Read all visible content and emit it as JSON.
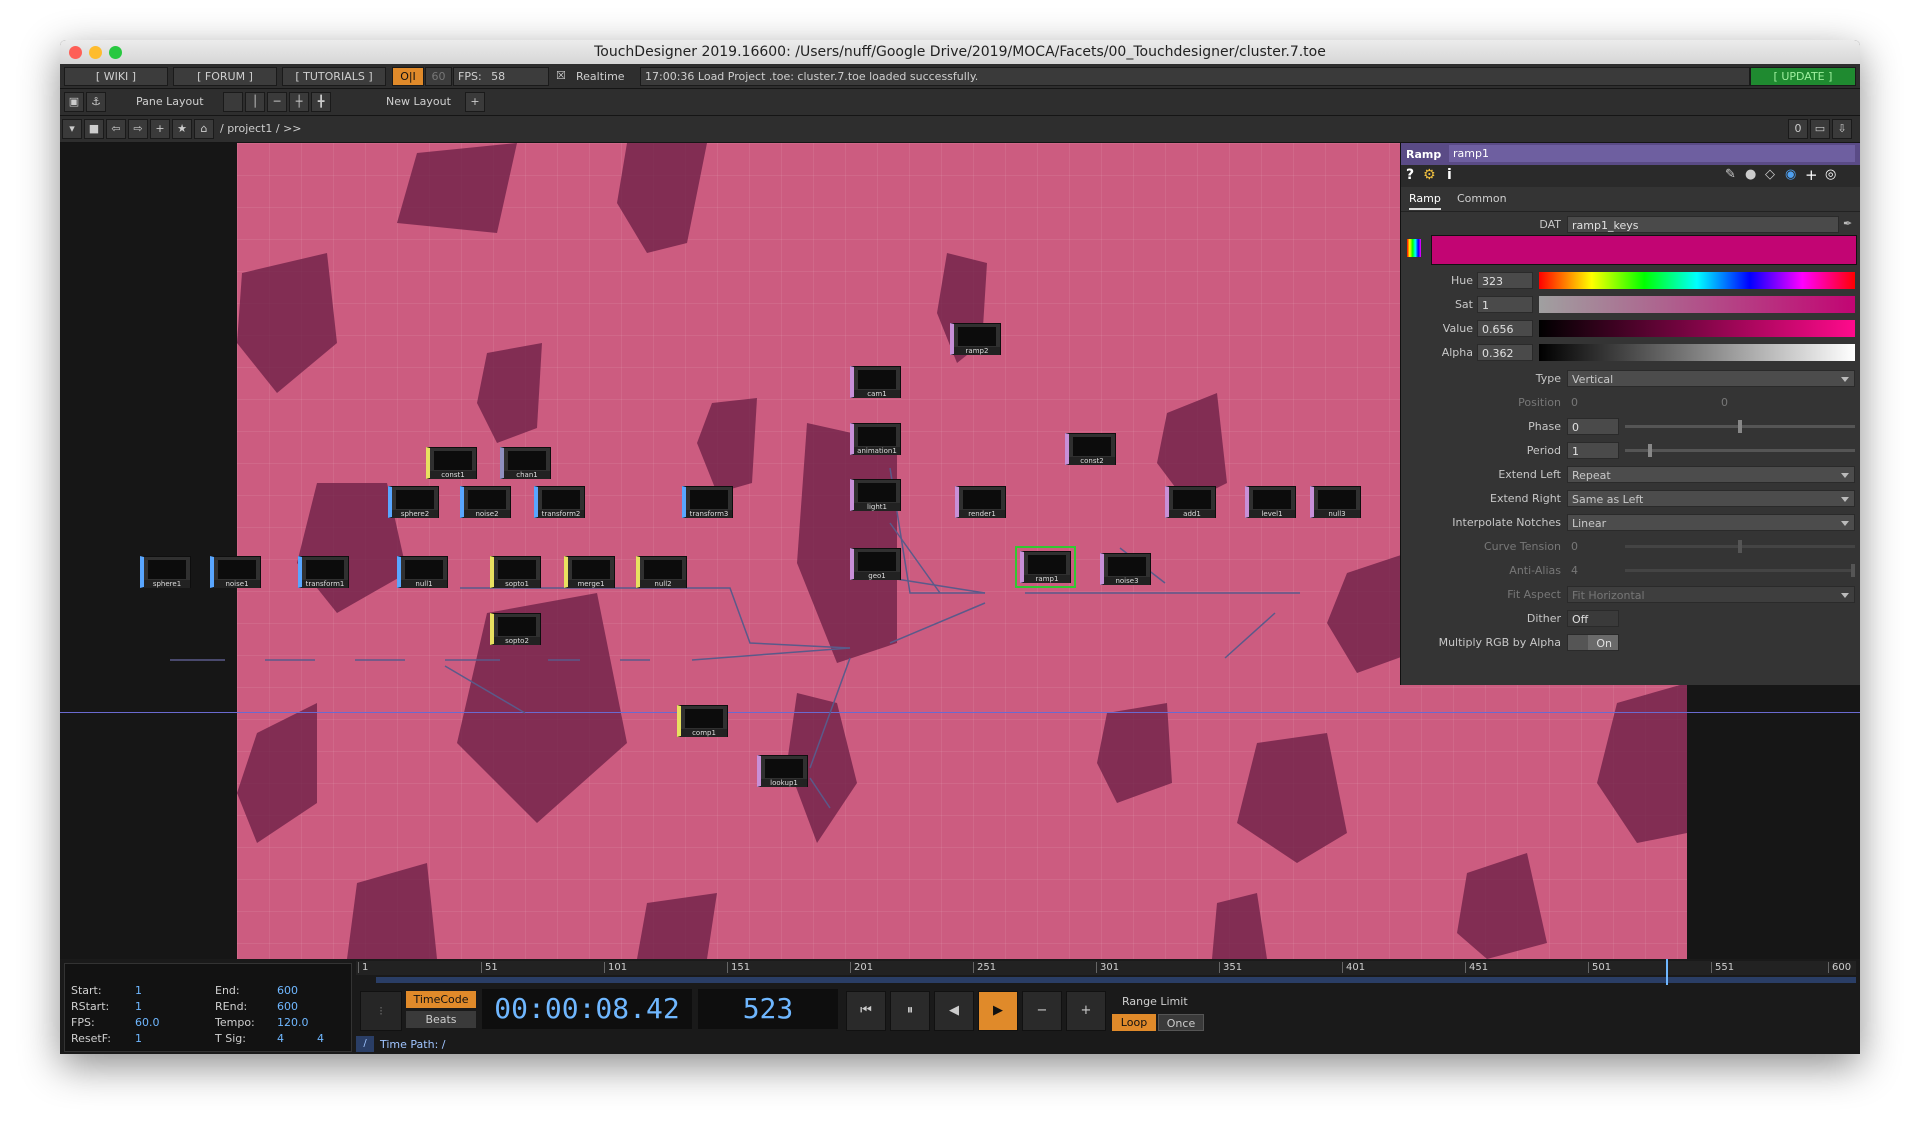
{
  "window": {
    "title": "TouchDesigner 2019.16600: /Users/nuff/Google Drive/2019/MOCA/Facets/00_Touchdesigner/cluster.7.toe"
  },
  "toolbar": {
    "wiki": "[ WIKI ]",
    "forum": "[ FORUM ]",
    "tutorials": "[ TUTORIALS ]",
    "oi": "O|I",
    "sixty": "60",
    "fps_label": "FPS:",
    "fps_value": "58",
    "realtime_check": "☒",
    "realtime": "Realtime",
    "status": "17:00:36 Load Project .toe: cluster.7.toe loaded successfully.",
    "update": "[ UPDATE ]"
  },
  "layoutbar": {
    "pane_layout": "Pane Layout",
    "new_layout": "New Layout",
    "plus": "+"
  },
  "pathbar": {
    "path": "/ project1 / >>",
    "counter": "0"
  },
  "nodes": [
    {
      "name": "sphere1",
      "color": "#59a6ff"
    },
    {
      "name": "noise1",
      "color": "#59a6ff"
    },
    {
      "name": "transform1",
      "color": "#59a6ff"
    },
    {
      "name": "null1",
      "color": "#59a6ff"
    },
    {
      "name": "sopto1",
      "color": "#e8e060"
    },
    {
      "name": "merge1",
      "color": "#e8e060"
    },
    {
      "name": "null2",
      "color": "#e8e060"
    },
    {
      "name": "sopto2",
      "color": "#e8e060"
    },
    {
      "name": "const1",
      "color": "#e8e060"
    },
    {
      "name": "chan1",
      "color": "#9090c0"
    },
    {
      "name": "sphere2",
      "color": "#59a6ff"
    },
    {
      "name": "noise2",
      "color": "#59a6ff"
    },
    {
      "name": "transform2",
      "color": "#59a6ff"
    },
    {
      "name": "transform3",
      "color": "#59a6ff"
    },
    {
      "name": "cam1",
      "color": "#c88fd8"
    },
    {
      "name": "animation1",
      "color": "#c88fd8"
    },
    {
      "name": "light1",
      "color": "#c88fd8"
    },
    {
      "name": "geo1",
      "color": "#c88fd8"
    },
    {
      "name": "render1",
      "color": "#c88fd8"
    },
    {
      "name": "comp1",
      "color": "#e8e060"
    },
    {
      "name": "lookup1",
      "color": "#c88fd8"
    },
    {
      "name": "ramp1",
      "color": "#c88fd8"
    },
    {
      "name": "noise3",
      "color": "#c88fd8"
    },
    {
      "name": "const2",
      "color": "#c88fd8"
    },
    {
      "name": "add1",
      "color": "#c88fd8"
    },
    {
      "name": "level1",
      "color": "#c88fd8"
    },
    {
      "name": "null3",
      "color": "#c88fd8"
    },
    {
      "name": "ramp2",
      "color": "#c88fd8"
    }
  ],
  "param": {
    "op_type": "Ramp",
    "op_name": "ramp1",
    "tabs": [
      "Ramp",
      "Common"
    ],
    "dat_label": "DAT",
    "dat_value": "ramp1_keys",
    "key_color": "#c20573",
    "rows": [
      {
        "label": "Hue",
        "value": "323"
      },
      {
        "label": "Sat",
        "value": "1"
      },
      {
        "label": "Value",
        "value": "0.656"
      },
      {
        "label": "Alpha",
        "value": "0.362"
      }
    ],
    "menus": [
      {
        "label": "Type",
        "value": "Vertical"
      },
      {
        "label": "Extend Left",
        "value": "Repeat"
      },
      {
        "label": "Extend Right",
        "value": "Same as Left"
      },
      {
        "label": "Interpolate Notches",
        "value": "Linear"
      },
      {
        "label": "Fit Aspect",
        "value": "Fit Horizontal"
      }
    ],
    "position": {
      "label": "Position",
      "v1": "0",
      "v2": "0"
    },
    "phase": {
      "label": "Phase",
      "value": "0"
    },
    "period": {
      "label": "Period",
      "value": "1"
    },
    "curve": {
      "label": "Curve Tension",
      "value": "0"
    },
    "antialias": {
      "label": "Anti-Alias",
      "value": "4"
    },
    "dither": {
      "label": "Dither",
      "value": "Off"
    },
    "multiply": {
      "label": "Multiply RGB by Alpha",
      "value": "On"
    }
  },
  "timeline": {
    "ticks": [
      "1",
      "51",
      "101",
      "151",
      "201",
      "251",
      "301",
      "351",
      "401",
      "451",
      "501",
      "551",
      "600"
    ],
    "start_label": "Start:",
    "start": "1",
    "end_label": "End:",
    "end": "600",
    "rstart_label": "RStart:",
    "rstart": "1",
    "rend_label": "REnd:",
    "rend": "600",
    "fps_label": "FPS:",
    "fps": "60.0",
    "tempo_label": "Tempo:",
    "tempo": "120.0",
    "resetf_label": "ResetF:",
    "resetf": "1",
    "tsig_label": "T Sig:",
    "tsig1": "4",
    "tsig2": "4",
    "timecode_btn": "TimeCode",
    "beats_btn": "Beats",
    "timecode": "00:00:08.42",
    "frame": "523",
    "range_limit": "Range Limit",
    "loop": "Loop",
    "once": "Once",
    "time_path": "Time Path: /",
    "slash": "/",
    "current_frame": 523,
    "total_frames": 600
  }
}
